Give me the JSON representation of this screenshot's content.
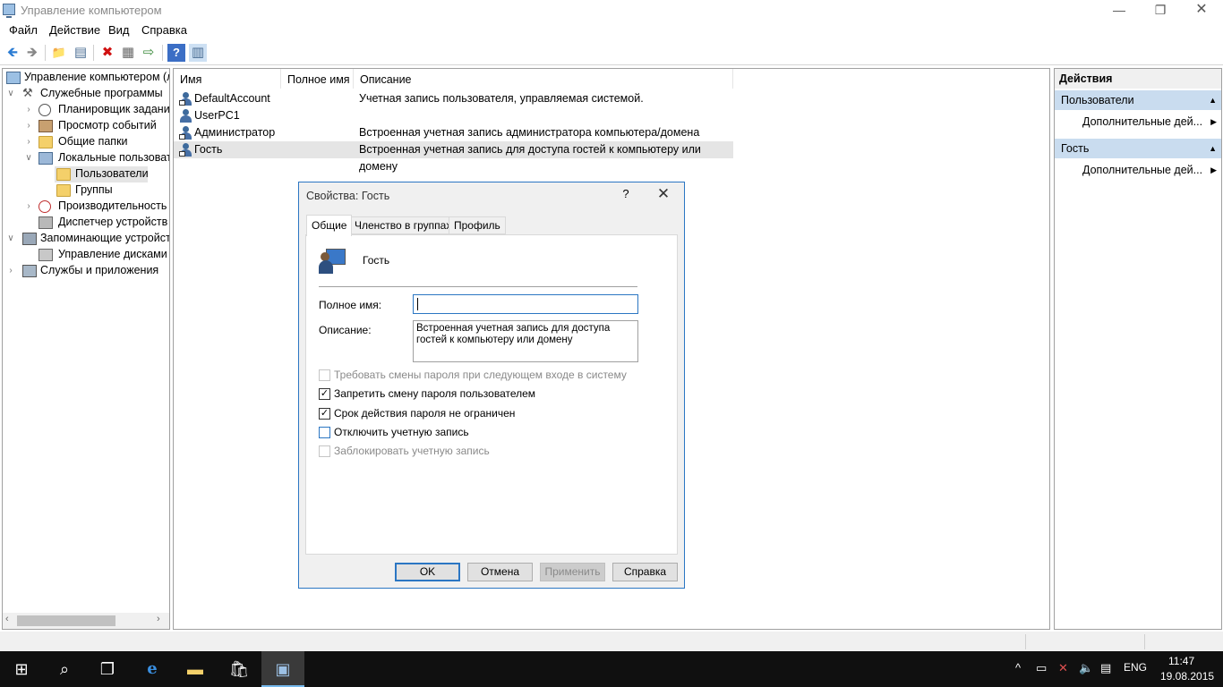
{
  "window": {
    "title": "Управление компьютером",
    "min": "—",
    "max": "❐",
    "close": "✕"
  },
  "menu": [
    "Файл",
    "Действие",
    "Вид",
    "Справка"
  ],
  "toolbar": {
    "back": "🡸",
    "forward": "🡺",
    "up": "📁",
    "show_tree": "▤",
    "delete": "✖",
    "properties": "▦",
    "export": "⇨",
    "help": "?",
    "show_action": "▥"
  },
  "tree": {
    "root": "Управление компьютером (л",
    "system_tools": "Служебные программы",
    "task_scheduler": "Планировщик заданий",
    "event_viewer": "Просмотр событий",
    "shared_folders": "Общие папки",
    "local_users": "Локальные пользовате",
    "users": "Пользователи",
    "groups": "Группы",
    "performance": "Производительность",
    "device_manager": "Диспетчер устройств",
    "storage": "Запоминающие устройст",
    "disk_management": "Управление дисками",
    "services": "Службы и приложения"
  },
  "list": {
    "columns": [
      "Имя",
      "Полное имя",
      "Описание"
    ],
    "rows": [
      {
        "name": "DefaultAccount",
        "fullname": "",
        "desc": "Учетная запись пользователя, управляемая системой."
      },
      {
        "name": "UserPC1",
        "fullname": "",
        "desc": ""
      },
      {
        "name": "Администратор",
        "fullname": "",
        "desc": "Встроенная учетная запись администратора компьютера/домена"
      },
      {
        "name": "Гость",
        "fullname": "",
        "desc": "Встроенная учетная запись для доступа гостей к компьютеру или домену"
      }
    ]
  },
  "actions": {
    "title": "Действия",
    "sections": [
      {
        "header": "Пользователи",
        "item": "Дополнительные дей..."
      },
      {
        "header": "Гость",
        "item": "Дополнительные дей..."
      }
    ]
  },
  "dialog": {
    "title": "Свойства: Гость",
    "help": "?",
    "close": "✕",
    "tabs": [
      "Общие",
      "Членство в группах",
      "Профиль"
    ],
    "user": "Гость",
    "fullname_label": "Полное имя:",
    "fullname_value": "",
    "desc_label": "Описание:",
    "desc_value": "Встроенная учетная запись для доступа гостей к компьютеру или домену",
    "checkboxes": [
      {
        "label": "Требовать смены пароля при следующем входе в систему",
        "checked": false,
        "disabled": true
      },
      {
        "label": "Запретить смену пароля пользователем",
        "checked": true,
        "disabled": false
      },
      {
        "label": "Срок действия пароля не ограничен",
        "checked": true,
        "disabled": false
      },
      {
        "label": "Отключить учетную запись",
        "checked": false,
        "disabled": false
      },
      {
        "label": "Заблокировать учетную запись",
        "checked": false,
        "disabled": true
      }
    ],
    "buttons": {
      "ok": "OK",
      "cancel": "Отмена",
      "apply": "Применить",
      "help": "Справка"
    }
  },
  "taskbar": {
    "lang": "ENG",
    "time": "11:47",
    "date": "19.08.2015"
  }
}
